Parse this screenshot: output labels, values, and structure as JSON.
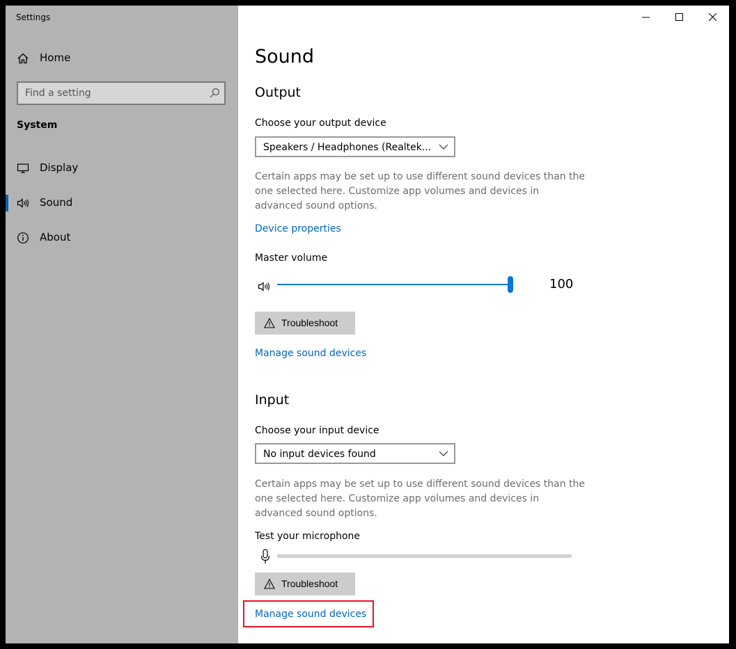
{
  "window": {
    "title": "Settings",
    "controls": {
      "minimize": "minimize",
      "maximize": "maximize",
      "close": "close"
    }
  },
  "sidebar": {
    "home_label": "Home",
    "search_placeholder": "Find a setting",
    "section_label": "System",
    "items": [
      {
        "label": "Display",
        "icon": "display-icon",
        "active": false
      },
      {
        "label": "Sound",
        "icon": "speaker-icon",
        "active": true
      },
      {
        "label": "About",
        "icon": "info-icon",
        "active": false
      }
    ]
  },
  "page": {
    "title": "Sound",
    "output": {
      "heading": "Output",
      "device_label": "Choose your output device",
      "device_value": "Speakers / Headphones (Realtek...",
      "description": "Certain apps may be set up to use different sound devices than the one selected here. Customize app volumes and devices in advanced sound options.",
      "device_properties_link": "Device properties",
      "master_volume_label": "Master volume",
      "master_volume_value": "100",
      "troubleshoot_label": "Troubleshoot",
      "manage_link": "Manage sound devices"
    },
    "input": {
      "heading": "Input",
      "device_label": "Choose your input device",
      "device_value": "No input devices found",
      "description": "Certain apps may be set up to use different sound devices than the one selected here. Customize app volumes and devices in advanced sound options.",
      "test_mic_label": "Test your microphone",
      "mic_level": 0,
      "troubleshoot_label": "Troubleshoot",
      "manage_link": "Manage sound devices"
    }
  },
  "colors": {
    "accent": "#0078d7",
    "link": "#0067b8",
    "sidebar_bg": "#b3b3b3",
    "highlight": "#e81123"
  }
}
